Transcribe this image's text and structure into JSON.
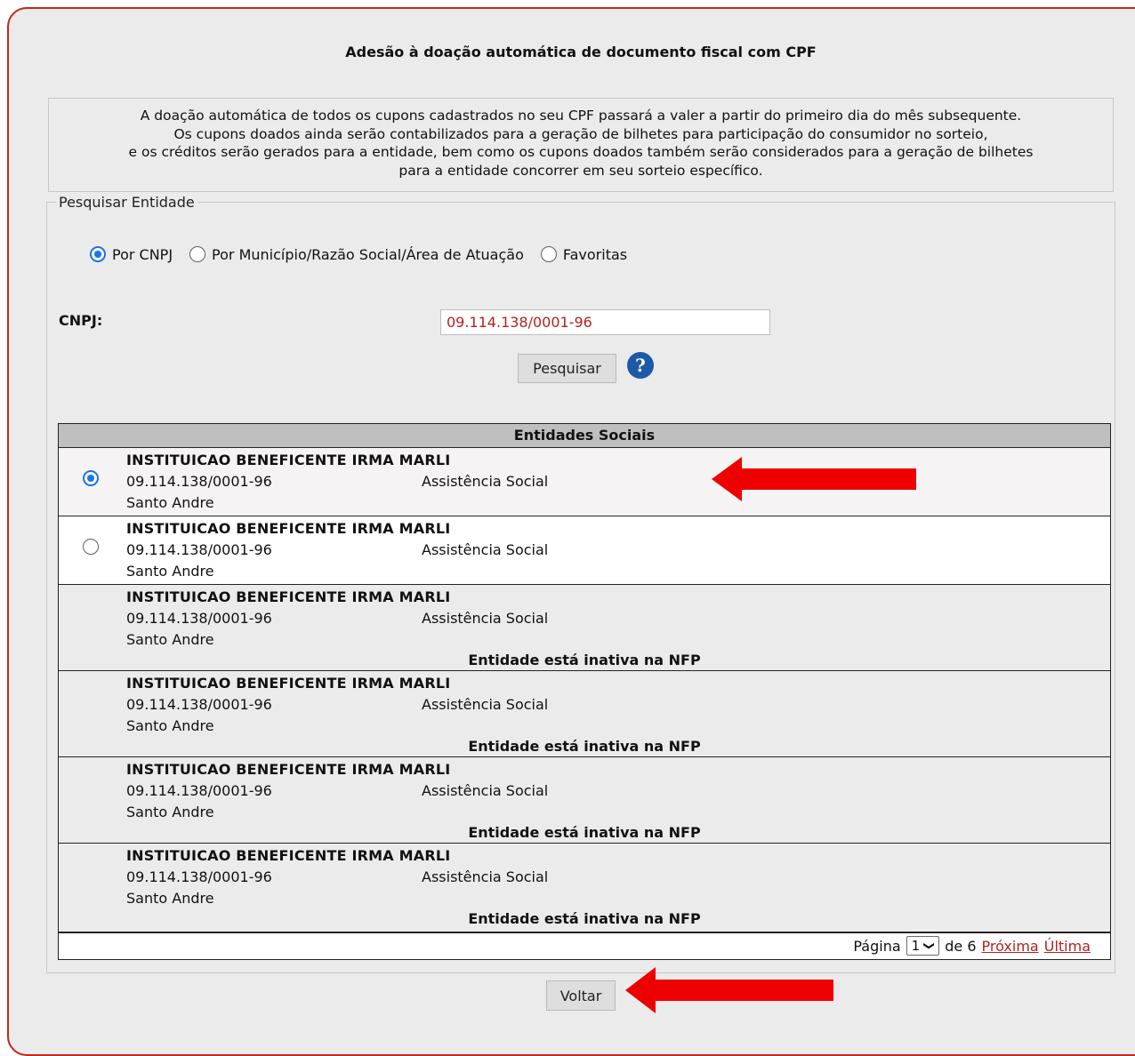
{
  "title": "Adesão à doação automática de documento fiscal com CPF",
  "notice_lines": [
    "A doação automática de todos os cupons cadastrados no seu CPF passará a valer a partir do primeiro dia do mês subsequente.",
    "Os cupons doados ainda serão contabilizados para a geração de bilhetes para participação do consumidor no sorteio,",
    "e os créditos serão gerados para a entidade, bem como os cupons doados também serão considerados para a geração de bilhetes",
    "para a entidade concorrer em seu sorteio específico."
  ],
  "search": {
    "legend": "Pesquisar Entidade",
    "options": [
      {
        "label": "Por CNPJ",
        "selected": true
      },
      {
        "label": "Por Município/Razão Social/Área de Atuação",
        "selected": false
      },
      {
        "label": "Favoritas",
        "selected": false
      }
    ],
    "cnpj_label": "CNPJ:",
    "cnpj_value": "09.114.138/0001-96",
    "search_button": "Pesquisar",
    "help_icon": "question-circle-icon"
  },
  "table": {
    "header": "Entidades Sociais",
    "rows": [
      {
        "name": "INSTITUICAO BENEFICENTE IRMA MARLI",
        "cnpj": "09.114.138/0001-96",
        "area": "Assistência Social",
        "city": "Santo Andre",
        "radio": "selected",
        "status": ""
      },
      {
        "name": "INSTITUICAO BENEFICENTE IRMA MARLI",
        "cnpj": "09.114.138/0001-96",
        "area": "Assistência Social",
        "city": "Santo Andre",
        "radio": "unselected",
        "status": ""
      },
      {
        "name": "INSTITUICAO BENEFICENTE IRMA MARLI",
        "cnpj": "09.114.138/0001-96",
        "area": "Assistência Social",
        "city": "Santo Andre",
        "radio": "none",
        "status": "Entidade está inativa na NFP"
      },
      {
        "name": "INSTITUICAO BENEFICENTE IRMA MARLI",
        "cnpj": "09.114.138/0001-96",
        "area": "Assistência Social",
        "city": "Santo Andre",
        "radio": "none",
        "status": "Entidade está inativa na NFP"
      },
      {
        "name": "INSTITUICAO BENEFICENTE IRMA MARLI",
        "cnpj": "09.114.138/0001-96",
        "area": "Assistência Social",
        "city": "Santo Andre",
        "radio": "none",
        "status": "Entidade está inativa na NFP"
      },
      {
        "name": "INSTITUICAO BENEFICENTE IRMA MARLI",
        "cnpj": "09.114.138/0001-96",
        "area": "Assistência Social",
        "city": "Santo Andre",
        "radio": "none",
        "status": "Entidade está inativa na NFP"
      }
    ],
    "pager": {
      "page_label": "Página",
      "current_page": "1",
      "of_label": "de 6",
      "next": "Próxima",
      "last": "Última"
    }
  },
  "back_button": "Voltar",
  "colors": {
    "frame_border": "#c3271c",
    "link": "#b0231f",
    "arrow": "#ee0000",
    "radio_selected": "#1a73e8",
    "help_icon": "#1c5aa8"
  }
}
